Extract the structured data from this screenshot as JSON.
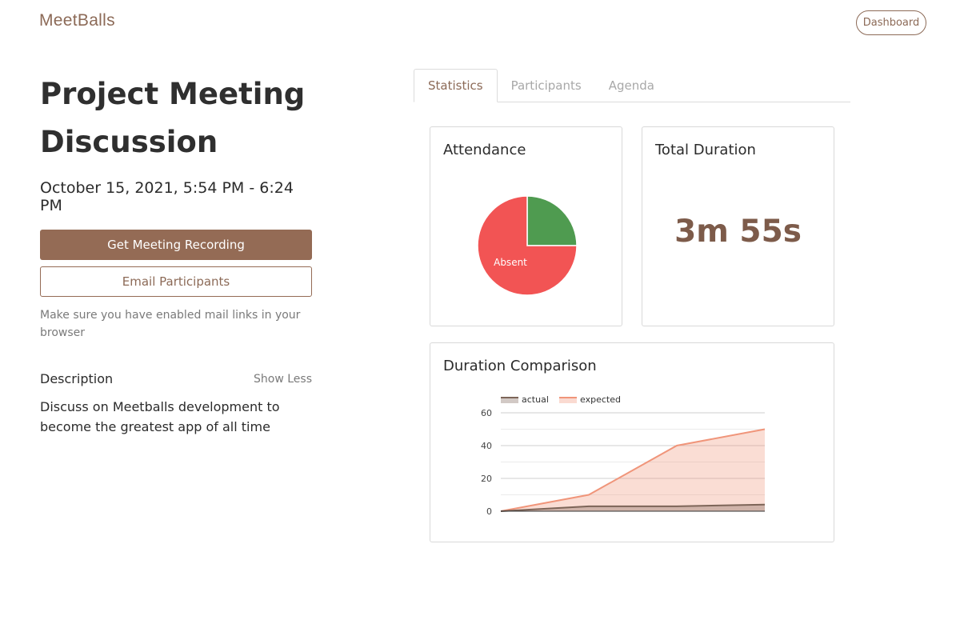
{
  "header": {
    "logo_text": "MeetBalls",
    "dashboard_label": "Dashboard"
  },
  "meeting": {
    "title_line1": "Project Meeting",
    "title_line2": "Discussion",
    "datetime": "October 15, 2021, 5:54 PM - 6:24 PM",
    "recording_label": "Get Meeting Recording",
    "email_label": "Email Participants",
    "mail_hint": "Make sure you have enabled mail links in your browser",
    "description_label": "Description",
    "show_less_label": "Show Less",
    "description_text": "Discuss on Meetballs development to become the greatest app of all time"
  },
  "tabs": [
    {
      "label": "Statistics",
      "active": true
    },
    {
      "label": "Participants",
      "active": false
    },
    {
      "label": "Agenda",
      "active": false
    }
  ],
  "attendance": {
    "title": "Attendance",
    "slice_label": "Absent"
  },
  "duration": {
    "title": "Total Duration",
    "value": "3m 55s"
  },
  "comparison": {
    "title": "Duration Comparison"
  },
  "colors": {
    "brand": "#946b55",
    "absent": "#f25454",
    "present": "#4f9b50",
    "actual": "#7d6558",
    "expected": "#f0957a"
  },
  "chart_data": [
    {
      "type": "pie",
      "title": "Attendance",
      "slices": [
        {
          "label": "Absent",
          "value": 75,
          "color": "#f25454"
        },
        {
          "label": "",
          "value": 25,
          "color": "#4f9b50"
        }
      ]
    },
    {
      "type": "area",
      "title": "Duration Comparison",
      "x": [
        0,
        1,
        2,
        3
      ],
      "ylim": [
        0,
        60
      ],
      "yticks": [
        0,
        20,
        40,
        60
      ],
      "grid": true,
      "legend": "top-left",
      "series": [
        {
          "name": "actual",
          "values": [
            0,
            3,
            3,
            4
          ],
          "color": "#7d6558"
        },
        {
          "name": "expected",
          "values": [
            0,
            10,
            40,
            50
          ],
          "color": "#f0957a"
        }
      ]
    }
  ]
}
